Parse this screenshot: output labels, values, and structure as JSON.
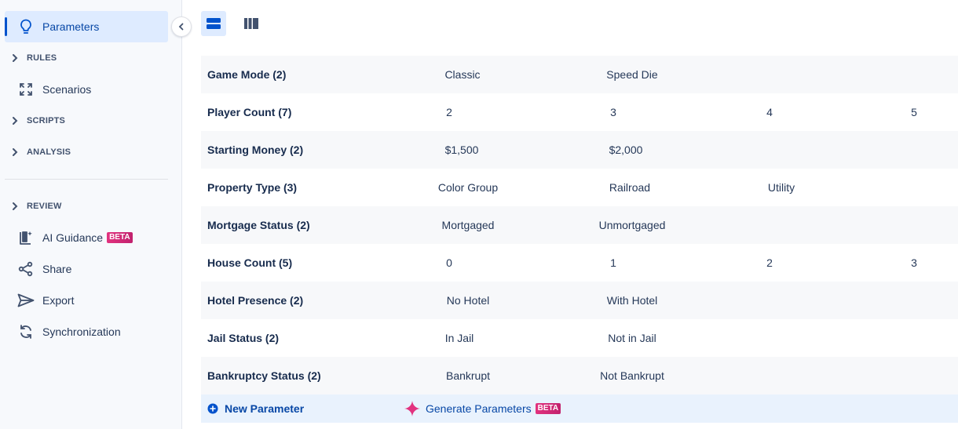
{
  "sidebar": {
    "items": [
      {
        "label": "Parameters",
        "icon": "lightbulb-icon",
        "active": true
      },
      {
        "label": "RULES",
        "icon": "chevron-right-icon",
        "section": true
      },
      {
        "label": "Scenarios",
        "icon": "expand-icon"
      },
      {
        "label": "SCRIPTS",
        "icon": "chevron-right-icon",
        "section": true
      },
      {
        "label": "ANALYSIS",
        "icon": "chevron-right-icon",
        "section": true
      },
      {
        "label": "REVIEW",
        "icon": "chevron-right-icon",
        "section": true
      },
      {
        "label": "AI Guidance",
        "icon": "ai-guidance-icon",
        "badge": "BETA"
      },
      {
        "label": "Share",
        "icon": "share-icon"
      },
      {
        "label": "Export",
        "icon": "send-icon"
      },
      {
        "label": "Synchronization",
        "icon": "sync-icon"
      }
    ]
  },
  "toolbar": {
    "views": [
      {
        "icon": "rows-view-icon",
        "active": true
      },
      {
        "icon": "columns-view-icon",
        "active": false
      }
    ]
  },
  "parameters": [
    {
      "name": "Game Mode (2)",
      "values": [
        "Classic",
        "Speed Die"
      ]
    },
    {
      "name": "Player Count (7)",
      "values": [
        "2",
        "3",
        "4",
        "5"
      ]
    },
    {
      "name": "Starting Money (2)",
      "values": [
        "$1,500",
        "$2,000"
      ]
    },
    {
      "name": "Property Type (3)",
      "values": [
        "Color Group",
        "Railroad",
        "Utility"
      ]
    },
    {
      "name": "Mortgage Status (2)",
      "values": [
        "Mortgaged",
        "Unmortgaged"
      ]
    },
    {
      "name": "House Count (5)",
      "values": [
        "0",
        "1",
        "2",
        "3"
      ]
    },
    {
      "name": "Hotel Presence (2)",
      "values": [
        "No Hotel",
        "With Hotel"
      ]
    },
    {
      "name": "Jail Status (2)",
      "values": [
        "In Jail",
        "Not in Jail"
      ]
    },
    {
      "name": "Bankruptcy Status (2)",
      "values": [
        "Bankrupt",
        "Not Bankrupt"
      ]
    }
  ],
  "footer": {
    "new_parameter": "New Parameter",
    "generate_parameters": "Generate Parameters",
    "generate_badge": "BETA"
  },
  "colors": {
    "accent": "#0052cc",
    "active_bg": "#deebff",
    "beta_badge": "#d62a78",
    "sparkle": "#e2327f"
  }
}
